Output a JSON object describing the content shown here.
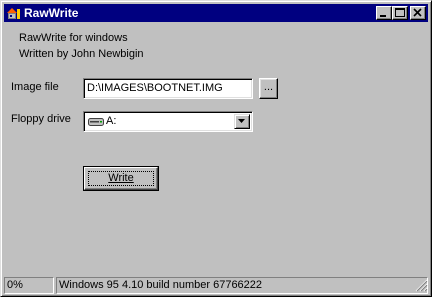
{
  "window": {
    "title": "RawWrite",
    "controls": {
      "minimize": "minimize-icon",
      "maximize": "maximize-icon",
      "close": "close-icon"
    }
  },
  "header": {
    "line1": "RawWrite for windows",
    "line2": "Written by John Newbigin"
  },
  "form": {
    "image_file_label": "Image file",
    "image_file_value": "D:\\IMAGES\\BOOTNET.IMG",
    "browse_label": "...",
    "floppy_drive_label": "Floppy drive",
    "floppy_drive_value": "A:",
    "floppy_drive_icon": "floppy-drive-icon",
    "write_label": "Write"
  },
  "status": {
    "progress": "0%",
    "info": "Windows 95 4.10 build number 67766222"
  },
  "colors": {
    "title_bar": "#000080",
    "face": "#c0c0c0"
  }
}
